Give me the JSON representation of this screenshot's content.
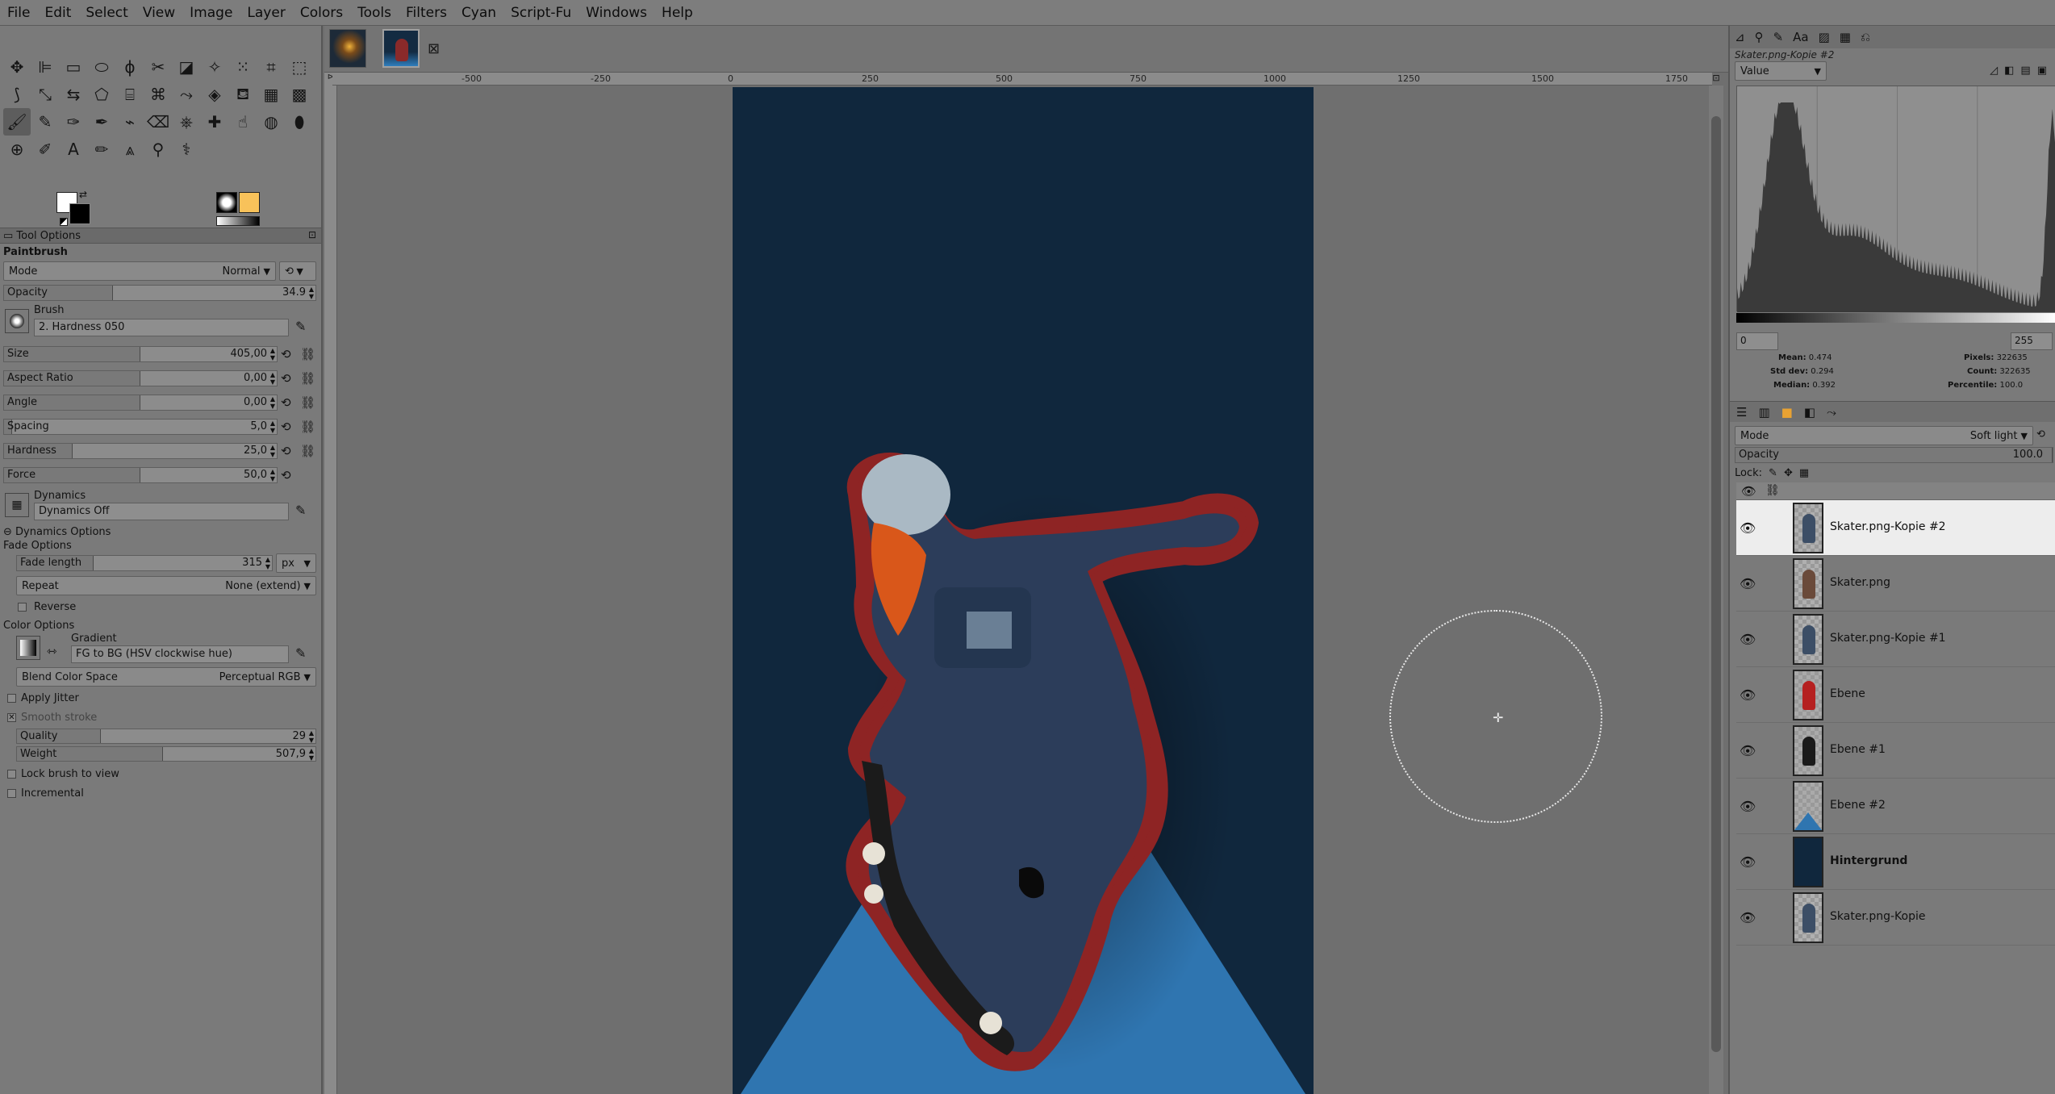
{
  "menubar": [
    "File",
    "Edit",
    "Select",
    "View",
    "Image",
    "Layer",
    "Colors",
    "Tools",
    "Filters",
    "Cyan",
    "Script-Fu",
    "Windows",
    "Help"
  ],
  "tools": [
    {
      "name": "move-tool-icon",
      "glyph": "✥"
    },
    {
      "name": "align-tool-icon",
      "glyph": "⊫"
    },
    {
      "name": "rect-select-icon",
      "glyph": "▭"
    },
    {
      "name": "ellipse-select-icon",
      "glyph": "⬭"
    },
    {
      "name": "free-select-icon",
      "glyph": "ϕ"
    },
    {
      "name": "scissors-select-icon",
      "glyph": "✂"
    },
    {
      "name": "foreground-select-icon",
      "glyph": "◪"
    },
    {
      "name": "fuzzy-select-icon",
      "glyph": "✧"
    },
    {
      "name": "by-color-select-icon",
      "glyph": "⁙"
    },
    {
      "name": "crop-tool-icon",
      "glyph": "⌗"
    },
    {
      "name": "unified-transform-icon",
      "glyph": "⬚"
    },
    {
      "name": "warp-transform-icon",
      "glyph": "⟆"
    },
    {
      "name": "handle-transform-icon",
      "glyph": "⤡"
    },
    {
      "name": "flip-tool-icon",
      "glyph": "⇆"
    },
    {
      "name": "perspective-tool-icon",
      "glyph": "⬠"
    },
    {
      "name": "3d-transform-icon",
      "glyph": "⌸"
    },
    {
      "name": "cage-transform-icon",
      "glyph": "⌘"
    },
    {
      "name": "paths-tool-icon",
      "glyph": "⤳"
    },
    {
      "name": "text-flip-icon",
      "glyph": "◈"
    },
    {
      "name": "bucket-fill-icon",
      "glyph": "⛾"
    },
    {
      "name": "gradient-tool-icon",
      "glyph": "▦"
    },
    {
      "name": "paint-tool-icon",
      "glyph": "▩"
    },
    {
      "name": "paintbrush-icon",
      "glyph": "🖌"
    },
    {
      "name": "pencil-icon",
      "glyph": "✎"
    },
    {
      "name": "airbrush-icon",
      "glyph": "✑"
    },
    {
      "name": "ink-icon",
      "glyph": "✒"
    },
    {
      "name": "mypaint-brush-icon",
      "glyph": "⌁"
    },
    {
      "name": "eraser-icon",
      "glyph": "⌫"
    },
    {
      "name": "clone-tool-icon",
      "glyph": "⎈"
    },
    {
      "name": "heal-tool-icon",
      "glyph": "✚"
    },
    {
      "name": "smudge-tool-icon",
      "glyph": "☝"
    },
    {
      "name": "blur-tool-icon",
      "glyph": "◍"
    },
    {
      "name": "dodge-burn-icon",
      "glyph": "⬮"
    },
    {
      "name": "measure-icon",
      "glyph": "⊕"
    },
    {
      "name": "paths-pen-icon",
      "glyph": "✐"
    },
    {
      "name": "text-tool-icon",
      "glyph": "A"
    },
    {
      "name": "color-picker-icon",
      "glyph": "✏"
    },
    {
      "name": "color-balance-icon",
      "glyph": "⩓"
    },
    {
      "name": "zoom-tool-icon",
      "glyph": "⚲"
    },
    {
      "name": "gegl-op-icon",
      "glyph": "⚕"
    }
  ],
  "tool_options": {
    "tab_label": "Tool Options",
    "tool_name": "Paintbrush",
    "mode_label": "Mode",
    "mode_value": "Normal",
    "opacity": {
      "label": "Opacity",
      "value": "34.9",
      "fraction": 0.349
    },
    "brush_label": "Brush",
    "brush_value": "2. Hardness 050",
    "size": {
      "label": "Size",
      "value": "405,00",
      "fraction": 0.5
    },
    "aspect_ratio": {
      "label": "Aspect Ratio",
      "value": "0,00",
      "fraction": 0.5
    },
    "angle": {
      "label": "Angle",
      "value": "0,00",
      "fraction": 0.5
    },
    "spacing": {
      "label": "Spacing",
      "value": "5,0",
      "fraction": 0.03
    },
    "hardness": {
      "label": "Hardness",
      "value": "25,0",
      "fraction": 0.25
    },
    "force": {
      "label": "Force",
      "value": "50,0",
      "fraction": 0.5
    },
    "dynamics_label": "Dynamics",
    "dynamics_value": "Dynamics Off",
    "dynamics_options": "Dynamics Options",
    "fade_options": "Fade Options",
    "fade_length": {
      "label": "Fade length",
      "value": "315",
      "fraction": 0.3
    },
    "fade_unit": "px",
    "repeat_label": "Repeat",
    "repeat_value": "None (extend)",
    "reverse_label": "Reverse",
    "color_options": "Color Options",
    "gradient_label": "Gradient",
    "gradient_value": "FG to BG (HSV clockwise hue)",
    "blend_label": "Blend Color Space",
    "blend_value": "Perceptual RGB",
    "apply_jitter": "Apply Jitter",
    "smooth_stroke": "Smooth stroke",
    "quality": {
      "label": "Quality",
      "value": "29",
      "fraction": 0.28
    },
    "weight": {
      "label": "Weight",
      "value": "507,9",
      "fraction": 0.49
    },
    "lock_brush": "Lock brush to view",
    "incremental": "Incremental"
  },
  "ruler": {
    "ticks": [
      "-500",
      "-250",
      "0",
      "250",
      "500",
      "750",
      "1000",
      "1250",
      "1500",
      "1750"
    ]
  },
  "colors": {
    "accent_bg": "#10273d",
    "outline_red": "#8e2424",
    "triangle_blue": "#2f75b0",
    "fg_color": "#ffffff",
    "bg_color": "#000000",
    "pattern_color": "#f8c25a"
  },
  "histogram": {
    "layer_name": "Skater.png-Kopie #2",
    "channel": "Value",
    "range_min": "0",
    "range_max": "255",
    "mean_label": "Mean:",
    "mean": "0.474",
    "stddev_label": "Std dev:",
    "stddev": "0.294",
    "median_label": "Median:",
    "median": "0.392",
    "pixels_label": "Pixels:",
    "pixels": "322635",
    "count_label": "Count:",
    "count": "322635",
    "percentile_label": "Percentile:",
    "percentile": "100.0"
  },
  "layers": {
    "mode_label": "Mode",
    "mode_value": "Soft light",
    "opacity_label": "Opacity",
    "opacity_value": "100.0",
    "lock_label": "Lock:",
    "items": [
      {
        "name": "Skater.png-Kopie #2",
        "selected": true,
        "bold": false,
        "thumb": "skater"
      },
      {
        "name": "Skater.png",
        "selected": false,
        "bold": false,
        "thumb": "skater-orange"
      },
      {
        "name": "Skater.png-Kopie #1",
        "selected": false,
        "bold": false,
        "thumb": "skater"
      },
      {
        "name": "Ebene",
        "selected": false,
        "bold": false,
        "thumb": "red"
      },
      {
        "name": "Ebene #1",
        "selected": false,
        "bold": false,
        "thumb": "black"
      },
      {
        "name": "Ebene #2",
        "selected": false,
        "bold": false,
        "thumb": "blue-triangle"
      },
      {
        "name": "Hintergrund",
        "selected": false,
        "bold": true,
        "thumb": "navy"
      },
      {
        "name": "Skater.png-Kopie",
        "selected": false,
        "bold": false,
        "thumb": "skater"
      }
    ]
  }
}
